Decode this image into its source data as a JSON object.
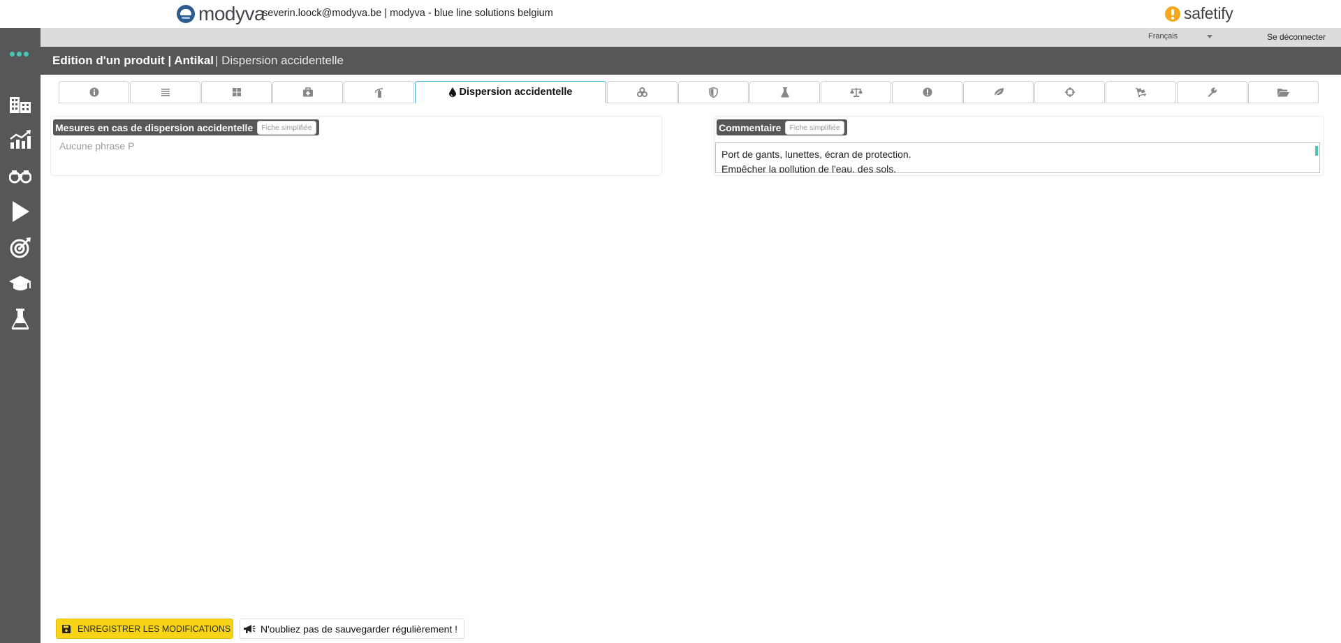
{
  "header": {
    "brand_name": "modyva",
    "user_info": "severin.loock@modyva.be | modyva - blue line solutions belgium",
    "product_brand": "safetify"
  },
  "langbar": {
    "language": "Français",
    "logout_label": "Se déconnecter"
  },
  "titlebar": {
    "title": "Edition d'un produit | Antikal",
    "subtitle": "| Dispersion accidentelle"
  },
  "sidebar": {
    "items": [
      {
        "icon": "buildings-icon"
      },
      {
        "icon": "chart-growth-icon"
      },
      {
        "icon": "binoculars-icon"
      },
      {
        "icon": "play-icon"
      },
      {
        "icon": "target-icon"
      },
      {
        "icon": "graduation-cap-icon"
      },
      {
        "icon": "flask-icon"
      }
    ]
  },
  "tabs": [
    {
      "icon": "info-icon"
    },
    {
      "icon": "list-icon"
    },
    {
      "icon": "grid-icon"
    },
    {
      "icon": "first-aid-icon"
    },
    {
      "icon": "extinguisher-icon"
    },
    {
      "icon": "drop-icon",
      "label": "Dispersion accidentelle",
      "active": true
    },
    {
      "icon": "biohazard-icon"
    },
    {
      "icon": "shield-icon"
    },
    {
      "icon": "flask-icon"
    },
    {
      "icon": "scale-icon"
    },
    {
      "icon": "warning-icon"
    },
    {
      "icon": "leaf-icon"
    },
    {
      "icon": "crosshair-icon"
    },
    {
      "icon": "cart-icon"
    },
    {
      "icon": "wrench-icon"
    },
    {
      "icon": "folder-open-icon"
    }
  ],
  "measures_panel": {
    "title": "Mesures en cas de dispersion accidentelle",
    "simplified_label": "Fiche simplifiée",
    "empty_text": "Aucune phrase P"
  },
  "comment_panel": {
    "title": "Commentaire",
    "simplified_label": "Fiche simplifiée",
    "lines": [
      "Port de gants, lunettes, écran de protection.",
      "Empêcher la pollution de l'eau, des sols."
    ]
  },
  "footer": {
    "save_label": "ENREGISTRER LES MODIFICATIONS",
    "reminder": "N'oubliez pas de sauvegarder régulièrement !"
  },
  "colors": {
    "sidebar_bg": "#555758",
    "accent_teal": "#4dc3b3",
    "active_tab_border": "#41b8d8",
    "save_button": "#f7d417"
  }
}
